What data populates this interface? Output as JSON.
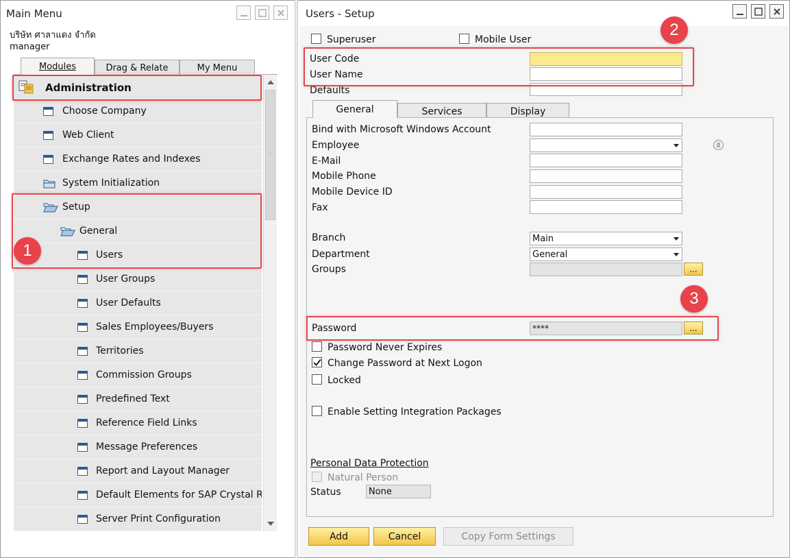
{
  "main_menu": {
    "title": "Main Menu",
    "company": "บริษัท ศาลาแดง จำกัด",
    "user": "manager",
    "tabs": [
      {
        "label": "Modules",
        "active": true
      },
      {
        "label": "Drag & Relate",
        "active": false
      },
      {
        "label": "My Menu",
        "active": false
      }
    ],
    "items": [
      {
        "label": "Administration",
        "icon": "administration-icon",
        "level": 0
      },
      {
        "label": "Choose Company",
        "icon": "window-icon",
        "level": 1
      },
      {
        "label": "Web Client",
        "icon": "window-icon",
        "level": 1
      },
      {
        "label": "Exchange Rates and Indexes",
        "icon": "window-icon",
        "level": 1
      },
      {
        "label": "System Initialization",
        "icon": "folder-closed-icon",
        "level": 1
      },
      {
        "label": "Setup",
        "icon": "folder-open-icon",
        "level": 1
      },
      {
        "label": "General",
        "icon": "folder-open-icon",
        "level": 2
      },
      {
        "label": "Users",
        "icon": "window-icon",
        "level": 3
      },
      {
        "label": "User Groups",
        "icon": "window-icon",
        "level": 3
      },
      {
        "label": "User Defaults",
        "icon": "window-icon",
        "level": 3
      },
      {
        "label": "Sales Employees/Buyers",
        "icon": "window-icon",
        "level": 3
      },
      {
        "label": "Territories",
        "icon": "window-icon",
        "level": 3
      },
      {
        "label": "Commission Groups",
        "icon": "window-icon",
        "level": 3
      },
      {
        "label": "Predefined Text",
        "icon": "window-icon",
        "level": 3
      },
      {
        "label": "Reference Field Links",
        "icon": "window-icon",
        "level": 3
      },
      {
        "label": "Message Preferences",
        "icon": "window-icon",
        "level": 3
      },
      {
        "label": "Report and Layout Manager",
        "icon": "window-icon",
        "level": 3
      },
      {
        "label": "Default Elements for SAP Crystal Rep",
        "icon": "window-icon",
        "level": 3
      },
      {
        "label": "Server Print Configuration",
        "icon": "window-icon",
        "level": 3
      }
    ]
  },
  "users_setup": {
    "title": "Users - Setup",
    "superuser_label": "Superuser",
    "mobile_user_label": "Mobile User",
    "user_code_label": "User Code",
    "user_code_value": "",
    "user_name_label": "User Name",
    "user_name_value": "",
    "defaults_label": "Defaults",
    "defaults_value": "",
    "tabs": [
      {
        "label": "General",
        "active": true
      },
      {
        "label": "Services",
        "active": false
      },
      {
        "label": "Display",
        "active": false
      }
    ],
    "general": {
      "bind_windows_label": "Bind with Microsoft Windows Account",
      "employee_label": "Employee",
      "email_label": "E-Mail",
      "mobile_phone_label": "Mobile Phone",
      "mobile_device_label": "Mobile Device ID",
      "fax_label": "Fax",
      "branch_label": "Branch",
      "branch_value": "Main",
      "department_label": "Department",
      "department_value": "General",
      "groups_label": "Groups",
      "dots": "...",
      "password_label": "Password",
      "password_value": "****",
      "pwd_never_expires_label": "Password Never Expires",
      "change_pwd_label": "Change Password at Next Logon",
      "change_pwd_checked": true,
      "locked_label": "Locked",
      "enable_integration_label": "Enable Setting Integration Packages",
      "pdp_label": "Personal Data Protection",
      "natural_person_label": "Natural Person",
      "status_label": "Status",
      "status_value": "None"
    },
    "buttons": {
      "add": "Add",
      "cancel": "Cancel",
      "copy_form": "Copy Form Settings"
    }
  },
  "annotations": [
    "1",
    "2",
    "3"
  ],
  "colors": {
    "annotation_red": "#e0474c",
    "required_field_yellow": "#fde98e",
    "button_gold": "#f2c54a",
    "menu_bg": "#e7e7e7",
    "icon_blue": "#2e5a8c"
  }
}
